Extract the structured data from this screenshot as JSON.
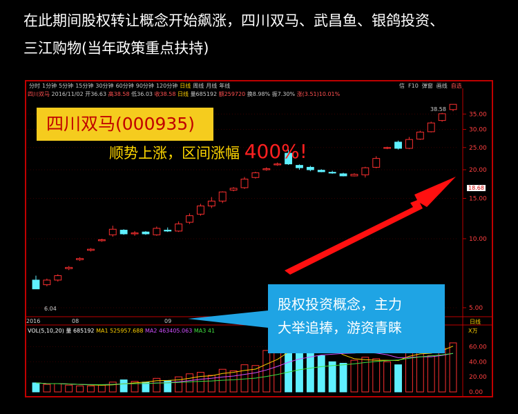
{
  "headline": {
    "line1": "在此期间股权转让概念开始飙涨，四川双马、武昌鱼、银鸽投资、",
    "line2": "三江购物(当年政策重点扶持)"
  },
  "toolbar": {
    "periods": [
      "分时",
      "1分钟",
      "5分钟",
      "15分钟",
      "30分钟",
      "60分钟",
      "90分钟",
      "120分钟",
      "日线",
      "周线",
      "月线",
      "年线"
    ],
    "active": "日线",
    "right_buttons": [
      "信",
      "F10",
      "弹窗",
      "画线",
      "自选"
    ]
  },
  "quote": {
    "name": "四川双马",
    "date": "2016/11/02",
    "open": "开36.63",
    "high": "高38.58",
    "low": "低36.03",
    "close": "收38.58",
    "board": "日线",
    "volume": "量685192",
    "amount": "额259720",
    "turnover": "换8.98%",
    "amplitude": "振7.30%",
    "change": "涨(3.51)10.01%"
  },
  "overlay": {
    "stock_label": "四川双马(000935)",
    "gain_text": "顺势上涨，区间涨幅",
    "gain_pct": "400%!",
    "callout_line1": "股权投资概念，主力",
    "callout_line2": "大举追捧，游资青睐"
  },
  "price_axis": {
    "ticks": [
      "35.00",
      "30.00",
      "25.00",
      "20.00",
      "15.00",
      "10.00",
      "5.00"
    ],
    "high_label": "38.58",
    "low_label": "6.04",
    "current_tag": "18.68"
  },
  "time_axis": {
    "ticks": [
      "2016",
      "08",
      "09"
    ],
    "right_label": "日线",
    "unit": "X万"
  },
  "volume_panel": {
    "label": "VOL(5,10,20)",
    "vol": "量 685192",
    "ma1": "MA1 525957.688",
    "ma2": "MA2 463405.063",
    "ma3": "MA3 41",
    "ticks": [
      "60.00",
      "40.00",
      "20.00",
      "0.00"
    ]
  },
  "colors": {
    "up": "#ff3030",
    "down": "#5ff0ff",
    "frame": "#c00000",
    "label_bg": "#f5cc1e",
    "callout_bg": "#1fa4e4",
    "arrow": "#ff1010"
  },
  "chart_data": {
    "type": "candlestick",
    "candles": [
      {
        "o": 6.6,
        "h": 6.9,
        "l": 6.04,
        "c": 6.04
      },
      {
        "o": 6.3,
        "h": 6.7,
        "l": 6.2,
        "c": 6.6
      },
      {
        "o": 6.6,
        "h": 7.0,
        "l": 6.5,
        "c": 6.9
      },
      {
        "o": 7.4,
        "h": 7.6,
        "l": 7.3,
        "c": 7.5
      },
      {
        "o": 8.1,
        "h": 8.3,
        "l": 8.0,
        "c": 8.2
      },
      {
        "o": 8.9,
        "h": 9.1,
        "l": 8.8,
        "c": 9.0
      },
      {
        "o": 9.8,
        "h": 10.0,
        "l": 9.7,
        "c": 9.9
      },
      {
        "o": 10.4,
        "h": 11.4,
        "l": 10.2,
        "c": 11.0
      },
      {
        "o": 10.9,
        "h": 11.0,
        "l": 10.4,
        "c": 10.5
      },
      {
        "o": 10.5,
        "h": 10.8,
        "l": 10.3,
        "c": 10.6
      },
      {
        "o": 10.7,
        "h": 10.8,
        "l": 10.4,
        "c": 10.5
      },
      {
        "o": 10.4,
        "h": 11.3,
        "l": 10.3,
        "c": 11.1
      },
      {
        "o": 10.9,
        "h": 11.2,
        "l": 10.7,
        "c": 10.8
      },
      {
        "o": 10.8,
        "h": 11.9,
        "l": 10.7,
        "c": 11.6
      },
      {
        "o": 11.8,
        "h": 12.9,
        "l": 11.6,
        "c": 12.6
      },
      {
        "o": 12.8,
        "h": 14.2,
        "l": 12.6,
        "c": 13.9
      },
      {
        "o": 13.9,
        "h": 15.2,
        "l": 13.6,
        "c": 14.6
      },
      {
        "o": 14.6,
        "h": 16.1,
        "l": 14.3,
        "c": 16.0
      },
      {
        "o": 16.3,
        "h": 16.8,
        "l": 16.1,
        "c": 16.6
      },
      {
        "o": 16.7,
        "h": 18.6,
        "l": 16.5,
        "c": 18.2
      },
      {
        "o": 18.5,
        "h": 19.6,
        "l": 18.3,
        "c": 19.4
      },
      {
        "o": 20.0,
        "h": 20.5,
        "l": 19.8,
        "c": 20.2
      },
      {
        "o": 21.0,
        "h": 21.5,
        "l": 20.8,
        "c": 21.2
      },
      {
        "o": 23.6,
        "h": 24.5,
        "l": 21.0,
        "c": 21.2
      },
      {
        "o": 20.9,
        "h": 21.1,
        "l": 20.0,
        "c": 20.4
      },
      {
        "o": 20.5,
        "h": 20.8,
        "l": 19.7,
        "c": 20.0
      },
      {
        "o": 19.9,
        "h": 20.1,
        "l": 19.5,
        "c": 19.6
      },
      {
        "o": 19.5,
        "h": 19.8,
        "l": 19.2,
        "c": 19.4
      },
      {
        "o": 19.2,
        "h": 19.4,
        "l": 18.7,
        "c": 18.8
      },
      {
        "o": 18.8,
        "h": 19.3,
        "l": 18.7,
        "c": 19.1
      },
      {
        "o": 19.0,
        "h": 20.6,
        "l": 18.5,
        "c": 20.4
      },
      {
        "o": 20.5,
        "h": 22.9,
        "l": 20.3,
        "c": 22.4
      },
      {
        "o": 24.8,
        "h": 25.2,
        "l": 24.6,
        "c": 25.0
      },
      {
        "o": 26.4,
        "h": 26.8,
        "l": 24.5,
        "c": 24.8
      },
      {
        "o": 24.8,
        "h": 27.8,
        "l": 24.6,
        "c": 27.1
      },
      {
        "o": 27.2,
        "h": 29.6,
        "l": 27.0,
        "c": 29.2
      },
      {
        "o": 29.3,
        "h": 32.4,
        "l": 29.1,
        "c": 32.0
      },
      {
        "o": 32.8,
        "h": 35.4,
        "l": 32.4,
        "c": 35.1
      },
      {
        "o": 36.6,
        "h": 38.58,
        "l": 36.03,
        "c": 38.58
      }
    ],
    "volume": [
      12,
      10,
      11,
      9,
      8,
      8,
      9,
      13,
      16,
      14,
      13,
      18,
      15,
      20,
      24,
      26,
      22,
      30,
      28,
      36,
      35,
      55,
      62,
      75,
      68,
      52,
      48,
      40,
      38,
      42,
      46,
      44,
      40,
      36,
      70,
      62,
      48,
      58,
      65
    ],
    "ylim": [
      4.6,
      40
    ],
    "vol_ylim": [
      0,
      75
    ],
    "y_scale": "log"
  }
}
